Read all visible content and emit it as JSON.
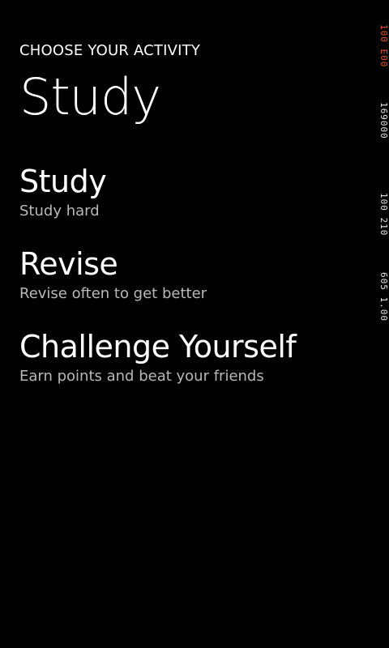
{
  "header": {
    "app_title": "CHOOSE YOUR ACTIVITY",
    "page_title": "Study"
  },
  "menu": {
    "items": [
      {
        "title": "Study",
        "subtitle": "Study hard"
      },
      {
        "title": "Revise",
        "subtitle": "Revise often to get better"
      },
      {
        "title": "Challenge Yourself",
        "subtitle": "Earn points and beat your friends"
      }
    ]
  },
  "frame_counters": {
    "line1": "100 E00",
    "line2": "169000",
    "line3": "100 210",
    "line4": "605 1.00"
  },
  "colors": {
    "background": "#000000",
    "text": "#ffffff",
    "subtext": "#b8b8b8",
    "counter_highlight": "#e8552b"
  }
}
